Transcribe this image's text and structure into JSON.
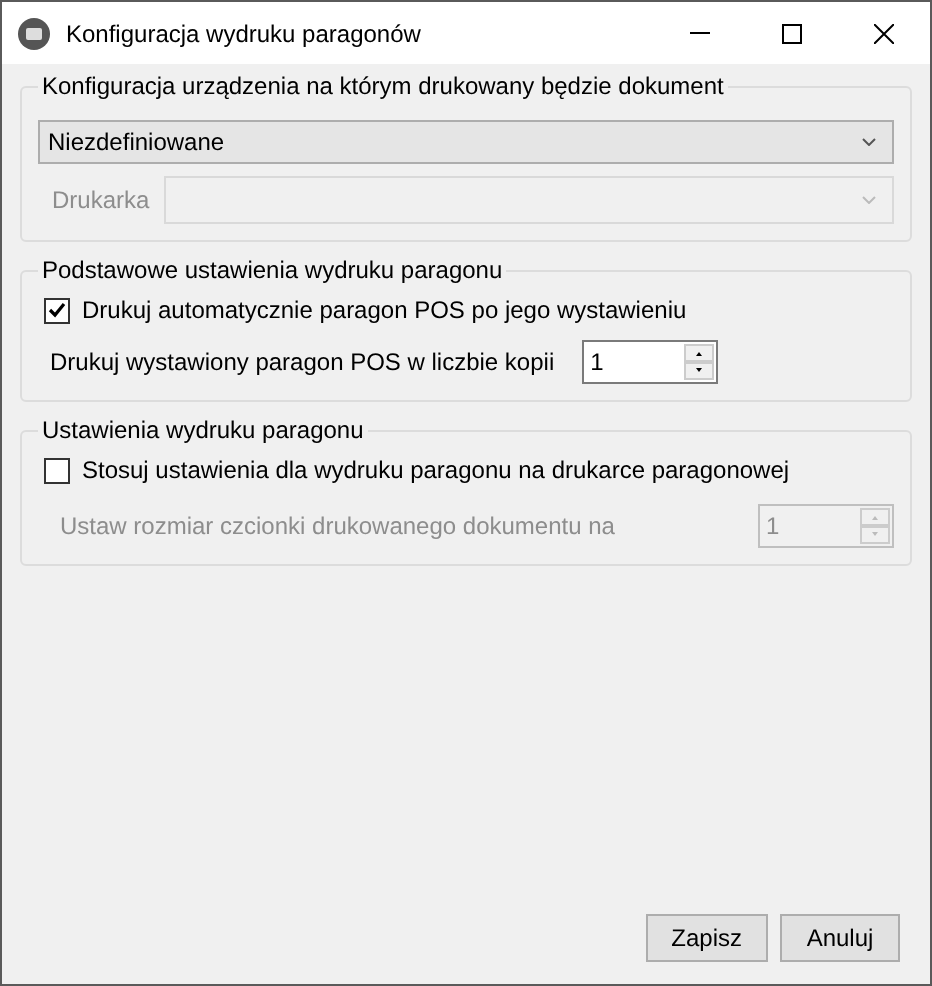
{
  "window": {
    "title": "Konfiguracja wydruku paragonów"
  },
  "groups": [
    {
      "title": "Konfiguracja urządzenia na którym drukowany będzie dokument",
      "controls": [
        {
          "kind": "dropdown",
          "value": "Niezdefiniowane",
          "disabled": false
        },
        {
          "kind": "labeled_dropdown",
          "label": "Drukarka",
          "disabled": true
        }
      ]
    },
    {
      "title": "Podstawowe ustawienia wydruku paragonu",
      "controls": [
        {
          "kind": "checkbox",
          "label": "Drukuj automatycznie paragon POS po jego wystawieniu",
          "checked": true
        },
        {
          "kind": "spinner",
          "label": "Drukuj wystawiony paragon POS w liczbie kopii",
          "value": "1",
          "disabled": false
        }
      ]
    },
    {
      "title": "Ustawienia wydruku paragonu",
      "controls": [
        {
          "kind": "checkbox",
          "label": "Stosuj ustawienia dla wydruku paragonu na drukarce paragonowej",
          "checked": false
        },
        {
          "kind": "spinner",
          "label": "Ustaw rozmiar czcionki drukowanego dokumentu na",
          "value": "1",
          "disabled": true
        }
      ]
    }
  ],
  "buttons": [
    "Zapisz",
    "Anuluj"
  ]
}
